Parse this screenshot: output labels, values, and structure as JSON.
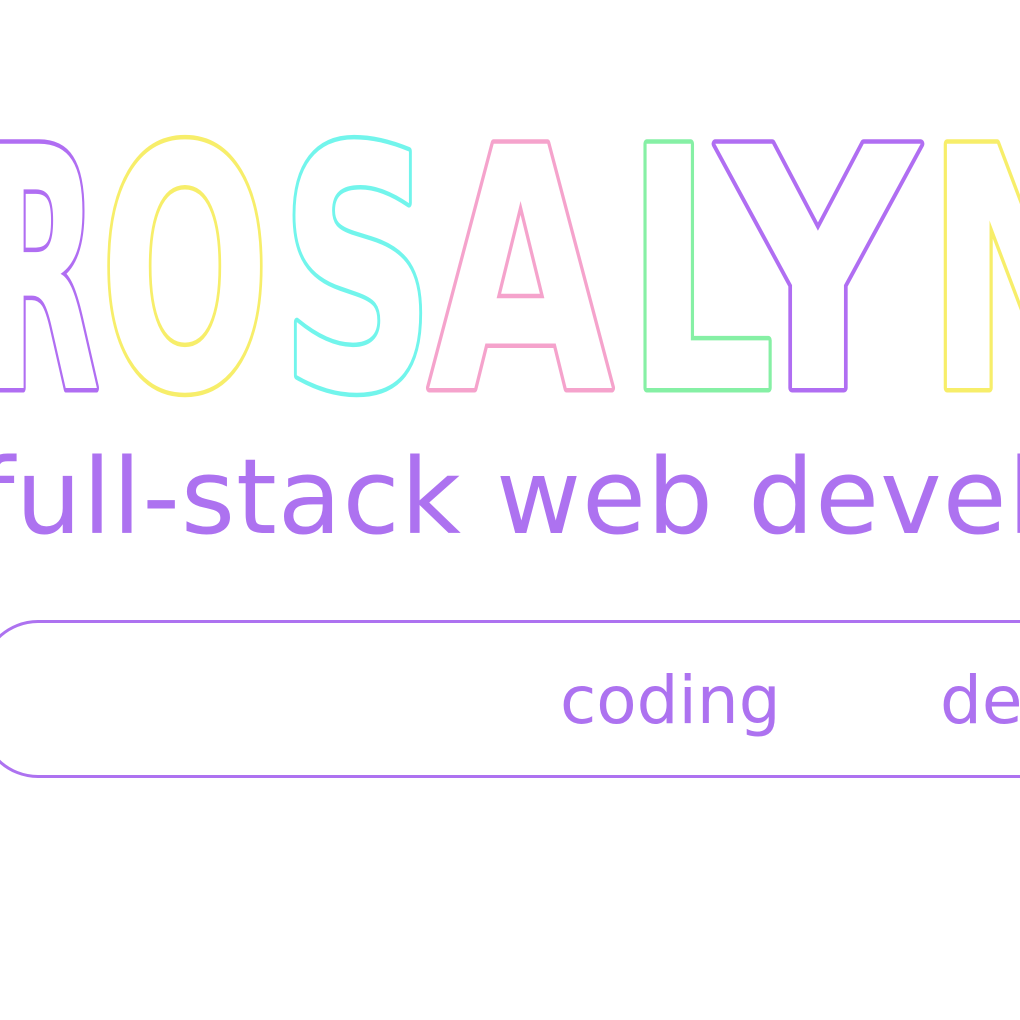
{
  "logo": {
    "letters": [
      {
        "char": "R",
        "color": "#b06ef2"
      },
      {
        "char": "O",
        "color": "#f7ee6a"
      },
      {
        "char": "S",
        "color": "#72f5ec"
      },
      {
        "char": "A",
        "color": "#f5a3cc"
      },
      {
        "char": "L",
        "color": "#86f0a5"
      },
      {
        "char": "Y",
        "color": "#b06ef2"
      },
      {
        "char": "N",
        "color": "#f7ee6a"
      }
    ]
  },
  "header": {
    "subtitle": "full-stack web developer"
  },
  "nav": {
    "items": [
      {
        "label": "coding"
      },
      {
        "label": "design"
      }
    ]
  },
  "colors": {
    "accent": "#ad72f0",
    "background": "#ffffff"
  }
}
